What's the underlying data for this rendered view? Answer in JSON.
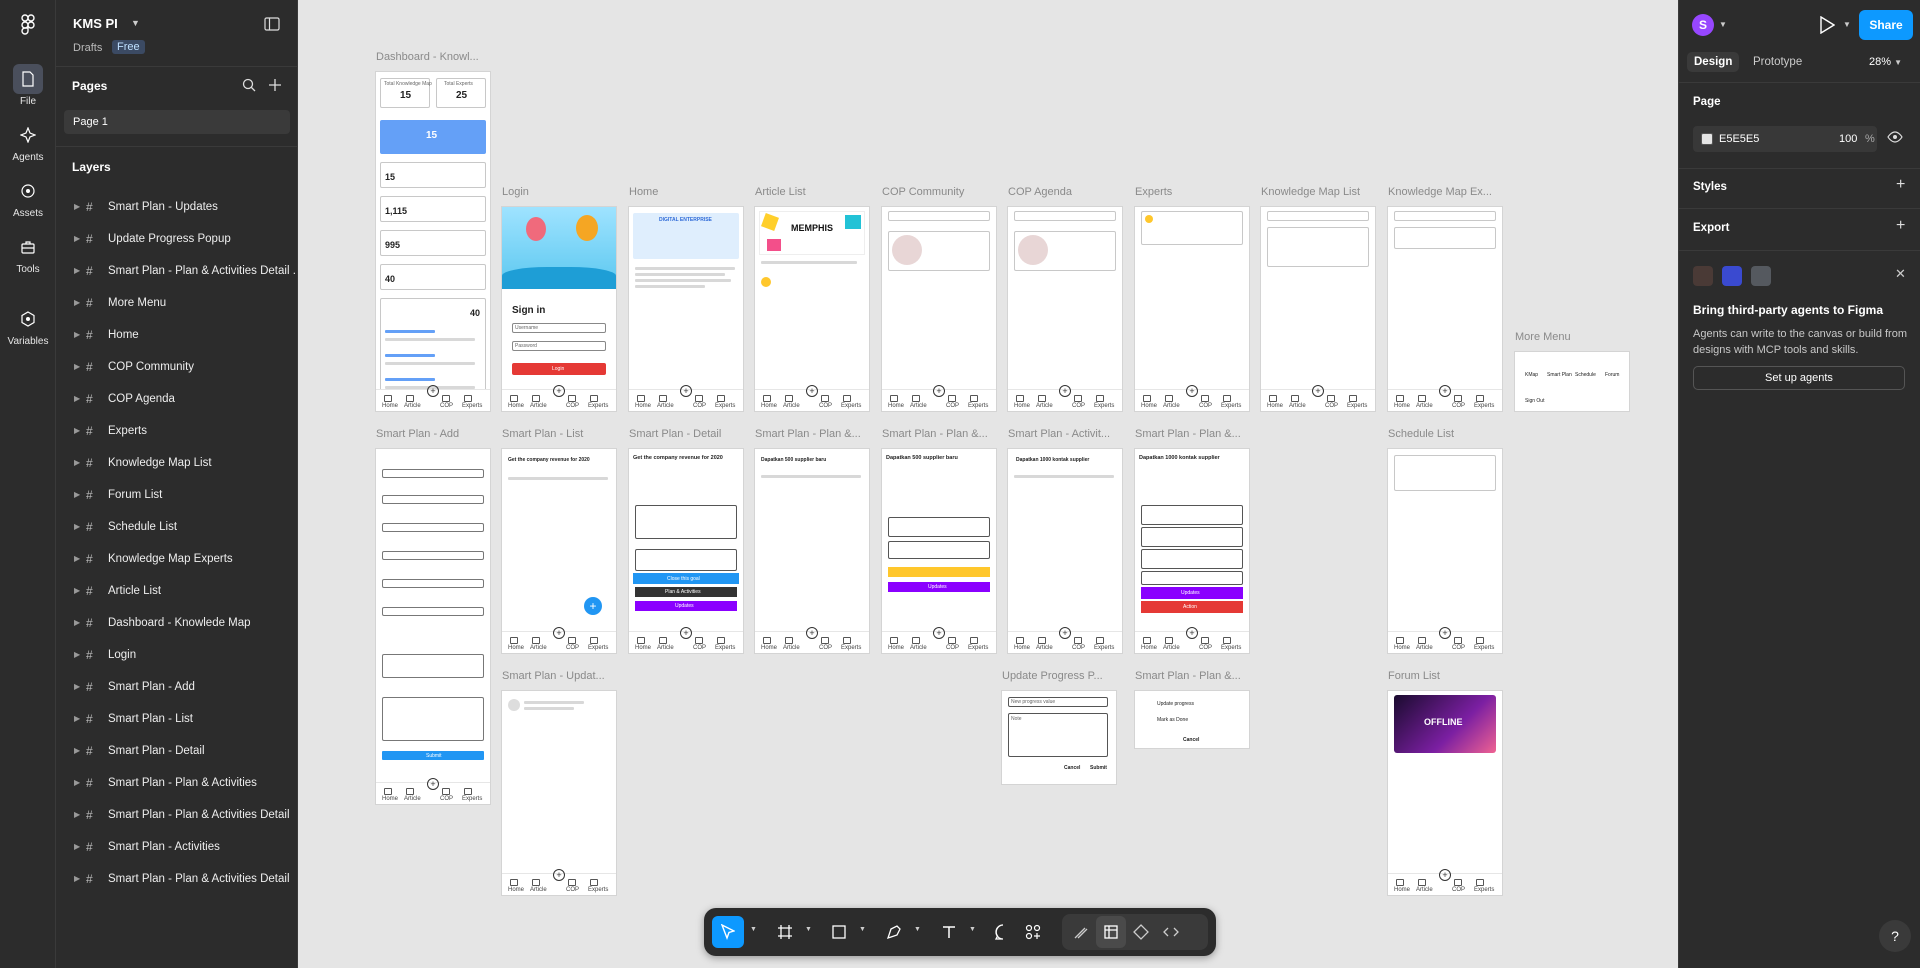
{
  "file": {
    "name": "KMS PI",
    "location": "Drafts",
    "plan_badge": "Free"
  },
  "rail": [
    {
      "label": "File",
      "icon": "file-icon"
    },
    {
      "label": "Agents",
      "icon": "agents-icon"
    },
    {
      "label": "Assets",
      "icon": "assets-icon"
    },
    {
      "label": "Tools",
      "icon": "tools-icon"
    },
    {
      "label": "Variables",
      "icon": "variables-icon"
    }
  ],
  "pages": {
    "title": "Pages",
    "items": [
      "Page 1"
    ]
  },
  "layers": {
    "title": "Layers",
    "items": [
      "Smart Plan - Updates",
      "Update Progress Popup",
      "Smart Plan - Plan & Activities Detail ...",
      "More Menu",
      "Home",
      "COP Community",
      "COP Agenda",
      "Experts",
      "Knowledge Map List",
      "Forum List",
      "Schedule List",
      "Knowledge Map Experts",
      "Article List",
      "Dashboard - Knowlede Map",
      "Login",
      "Smart Plan - Add",
      "Smart Plan - List",
      "Smart Plan - Detail",
      "Smart Plan - Plan & Activities",
      "Smart Plan - Plan & Activities Detail",
      "Smart Plan - Activities",
      "Smart Plan - Plan & Activities Detail"
    ]
  },
  "canvas": {
    "background": "#E5E5E5",
    "frame_labels": {
      "dashboard": "Dashboard - Knowl...",
      "login": "Login",
      "home": "Home",
      "article_list": "Article List",
      "cop_community": "COP Community",
      "cop_agenda": "COP Agenda",
      "experts": "Experts",
      "km_list": "Knowledge Map List",
      "km_experts": "Knowledge Map Ex...",
      "more_menu": "More Menu",
      "sp_add": "Smart Plan - Add",
      "sp_list": "Smart Plan - List",
      "sp_detail": "Smart Plan - Detail",
      "sp_pa1": "Smart Plan - Plan &...",
      "sp_pa2": "Smart Plan - Plan &...",
      "sp_act": "Smart Plan - Activit...",
      "sp_pa3": "Smart Plan - Plan &...",
      "schedule": "Schedule List",
      "sp_updates": "Smart Plan - Updat...",
      "update_popup": "Update Progress P...",
      "sp_pa4": "Smart Plan - Plan &...",
      "forum": "Forum List"
    },
    "frame_content": {
      "dash_total_km": "Total Knowledge Map",
      "dash_total_km_val": "15",
      "dash_total_exp": "Total Experts",
      "dash_total_exp_val": "25",
      "dash_v1": "15",
      "dash_v2": "15",
      "dash_v3": "1,115",
      "dash_v4": "995",
      "dash_v5": "40",
      "dash_v6": "40",
      "login_title": "Sign in",
      "login_user": "Username",
      "login_pass": "Password",
      "login_btn": "Login",
      "home_banner": "DIGITAL ENTERPRISE",
      "article_banner": "MEMPHIS",
      "sp_title": "Get the company revenue for 2020",
      "sp_pa_title": "Dapatkan 500 supplier baru",
      "sp_act_title": "Dapatkan 1000 kontak supplier",
      "btn_close": "Close this goal",
      "btn_plan": "Plan & Activities",
      "btn_updates": "Updates",
      "btn_action": "Action",
      "btn_submit": "Submit",
      "popup_placeholder": "New progress value",
      "popup_note": "Note",
      "popup_cancel": "Cancel",
      "popup_submit": "Submit",
      "menu_update": "Update progress",
      "menu_done": "Mark as Done",
      "menu_cancel": "Cancel",
      "forum_banner": "OFFLINE",
      "more_items": [
        "KMap",
        "Smart Plan",
        "Schedule",
        "Forum",
        "Sign Out"
      ]
    },
    "bottom_nav": [
      "Home",
      "Article",
      "COP",
      "Experts"
    ]
  },
  "toolbar": {
    "tools": [
      "move-tool",
      "frame-tool",
      "shape-tool",
      "pen-tool",
      "text-tool",
      "comment-tool",
      "actions-tool",
      "draw-mode",
      "design-mode",
      "dev-mode",
      "code-mode"
    ]
  },
  "right": {
    "user_initial": "S",
    "share": "Share",
    "tabs": {
      "design": "Design",
      "prototype": "Prototype"
    },
    "zoom": "28%",
    "page_section": "Page",
    "bg_hex": "E5E5E5",
    "bg_opacity": "100",
    "pct": "%",
    "styles": "Styles",
    "export": "Export",
    "agents": {
      "title": "Bring third-party agents to Figma",
      "desc": "Agents can write to the canvas or build from designs with MCP tools and skills.",
      "button": "Set up agents"
    },
    "help": "?"
  },
  "colors": {
    "accent": "#0d99ff",
    "canvas": "#e5e5e5",
    "panel": "#2c2c2c",
    "purple": "#8a00ff",
    "red": "#e53935",
    "yellow": "#ffc72c",
    "blue": "#2196f3"
  }
}
